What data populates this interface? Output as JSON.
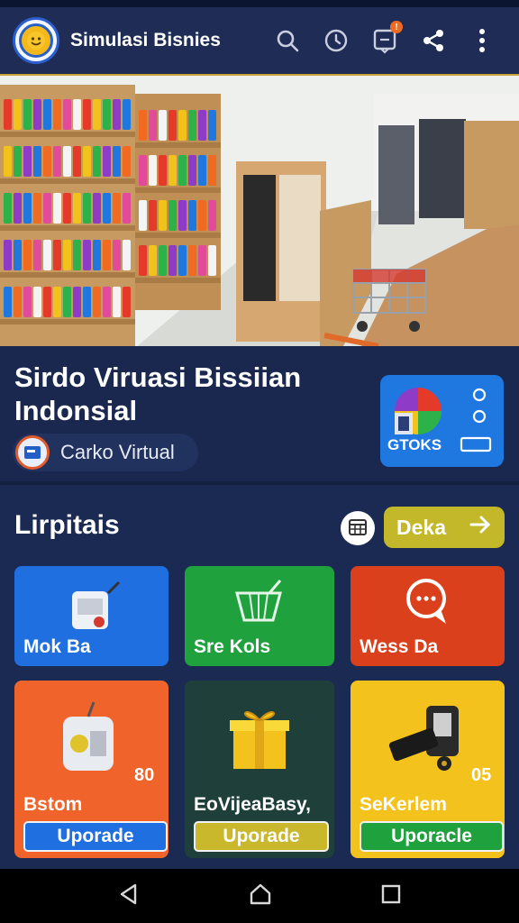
{
  "app": {
    "title": "Simulasi Bisnies",
    "icons": [
      "search-icon",
      "history-icon",
      "notification-icon",
      "share-icon",
      "more-icon"
    ],
    "notification_badge": "!"
  },
  "hero": {
    "image": "store-interior-photo",
    "colors": {
      "shelf_wood": "#c79a62",
      "floor": "#e6e8e4",
      "wall": "#eef0ee"
    }
  },
  "store": {
    "title": "Sirdo Viruasi Bissiian Indonsial",
    "chip_label": "Carko Virtual",
    "stocks_label": "GTOKS"
  },
  "section": {
    "title": "Lirpitais",
    "action_label": "Deka"
  },
  "tiles": [
    {
      "label": "Mok Ba",
      "color": "#1f6fe0",
      "icon": "store-machine-icon"
    },
    {
      "label": "Sre Kols",
      "color": "#1fa23e",
      "icon": "shopping-basket-icon"
    },
    {
      "label": "Wess Da",
      "color": "#d9401b",
      "icon": "chat-bubble-icon"
    }
  ],
  "upgrades": [
    {
      "label": "Bstom",
      "value": "80",
      "button": "Uporade",
      "color": "#f0642c",
      "button_color": "#1f6fe0",
      "icon": "machine-icon"
    },
    {
      "label": "EoVijeaBasy,",
      "value": "",
      "button": "Uporade",
      "color": "#1f5a36",
      "button_color": "#c9b82c",
      "icon": "gift-icon"
    },
    {
      "label": "SeKerlem",
      "value": "05",
      "button": "Uporacle",
      "color": "#f3c21c",
      "button_color": "#1fa23e",
      "icon": "scanner-icon"
    }
  ],
  "nav": {
    "icons": [
      "back-icon",
      "home-icon",
      "recents-icon"
    ]
  }
}
